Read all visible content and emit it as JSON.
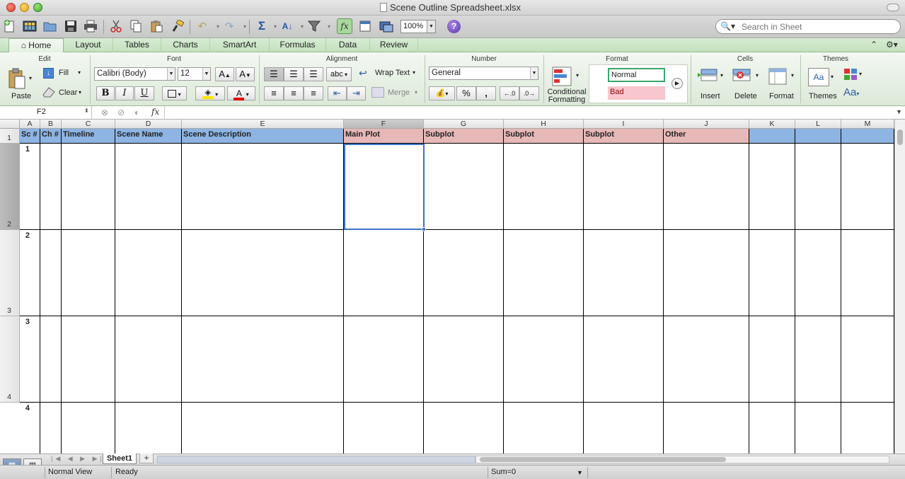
{
  "window": {
    "title": "Scene Outline Spreadsheet.xlsx"
  },
  "toolbar": {
    "zoom": "100%",
    "help_label": "?",
    "search_placeholder": "Search in Sheet"
  },
  "ribbon_tabs": [
    "Home",
    "Layout",
    "Tables",
    "Charts",
    "SmartArt",
    "Formulas",
    "Data",
    "Review"
  ],
  "ribbon": {
    "groups": {
      "edit": "Edit",
      "font": "Font",
      "alignment": "Alignment",
      "number": "Number",
      "format": "Format",
      "cells": "Cells",
      "themes": "Themes"
    },
    "edit": {
      "paste": "Paste",
      "fill": "Fill",
      "clear": "Clear"
    },
    "font": {
      "name": "Calibri (Body)",
      "size": "12",
      "bold": "B",
      "italic": "I",
      "underline": "U",
      "grow": "A",
      "shrink": "A"
    },
    "alignment": {
      "wrap_text": "Wrap Text",
      "merge": "Merge",
      "abc": "abc"
    },
    "number": {
      "format": "General",
      "percent": "%",
      "comma": ","
    },
    "format": {
      "conditional_line1": "Conditional",
      "conditional_line2": "Formatting",
      "style_normal": "Normal",
      "style_bad": "Bad"
    },
    "cells": {
      "insert": "Insert",
      "delete": "Delete",
      "format": "Format"
    },
    "themes": {
      "themes": "Themes",
      "aa": "Aa"
    }
  },
  "formula_bar": {
    "cell_ref": "F2",
    "fx": "fx",
    "content": ""
  },
  "sheet": {
    "columns": [
      "A",
      "B",
      "C",
      "D",
      "E",
      "F",
      "G",
      "H",
      "I",
      "J",
      "K",
      "L",
      "M"
    ],
    "selected_column": "F",
    "selected_row": "2",
    "row_numbers": [
      "1",
      "2",
      "3",
      "4"
    ],
    "headers": [
      "Sc #",
      "Ch #",
      "Timeline",
      "Scene Name",
      "Scene Description",
      "Main Plot",
      "Subplot",
      "Subplot",
      "Subplot",
      "Other",
      "",
      "",
      ""
    ],
    "scene_numbers": [
      "1",
      "2",
      "3",
      "4"
    ]
  },
  "sheet_tabs": {
    "active": "Sheet1",
    "add": "+"
  },
  "status": {
    "view": "Normal View",
    "state": "Ready",
    "sum": "Sum=0"
  },
  "colors": {
    "header_blue": "#8db4e2",
    "header_pink": "#e6b8b7",
    "ribbon_green": "#d7ecd4",
    "selection": "#3d73c9"
  }
}
